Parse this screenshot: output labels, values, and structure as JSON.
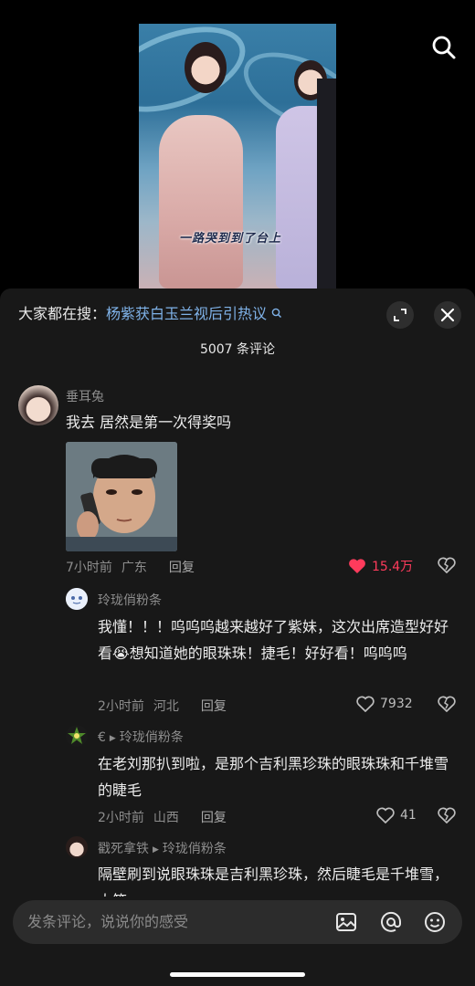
{
  "video": {
    "caption": "一路哭到到了台上"
  },
  "header": {
    "everyone_search_label": "大家都在搜：",
    "everyone_search_link": "杨紫获白玉兰视后引热议",
    "comment_count": "5007 条评论"
  },
  "comments": [
    {
      "username": "垂耳兔",
      "text": "我去 居然是第一次得奖吗",
      "time": "7小时前",
      "location": "广东",
      "reply_label": "回复",
      "likes": "15.4万"
    },
    {
      "username": "玲珑俏粉条",
      "text": "我懂！！！呜呜呜越来越好了紫妹，这次出席造型好好看😭想知道她的眼珠珠！捷毛！好好看！呜呜呜",
      "time": "2小时前",
      "location": "河北",
      "reply_label": "回复",
      "likes": "7932"
    },
    {
      "username": "€",
      "reply_to": "玲珑俏粉条",
      "text": "在老刘那扒到啦，是那个吉利黑珍珠的眼珠珠和千堆雪的睫毛",
      "time": "2小时前",
      "location": "山西",
      "reply_label": "回复",
      "likes": "41"
    },
    {
      "username": "戳死拿铁",
      "reply_to": "玲珑俏粉条",
      "text": "隔壁刷到说眼珠珠是吉利黑珍珠，然后睫毛是千堆雪，大笑",
      "time": "",
      "location": "",
      "reply_label": "",
      "likes": ""
    }
  ],
  "input": {
    "placeholder": "发条评论，说说你的感受"
  },
  "colors": {
    "sheet_bg": "#181818",
    "link": "#7fb2e8",
    "like_active": "#ff3b5c"
  }
}
